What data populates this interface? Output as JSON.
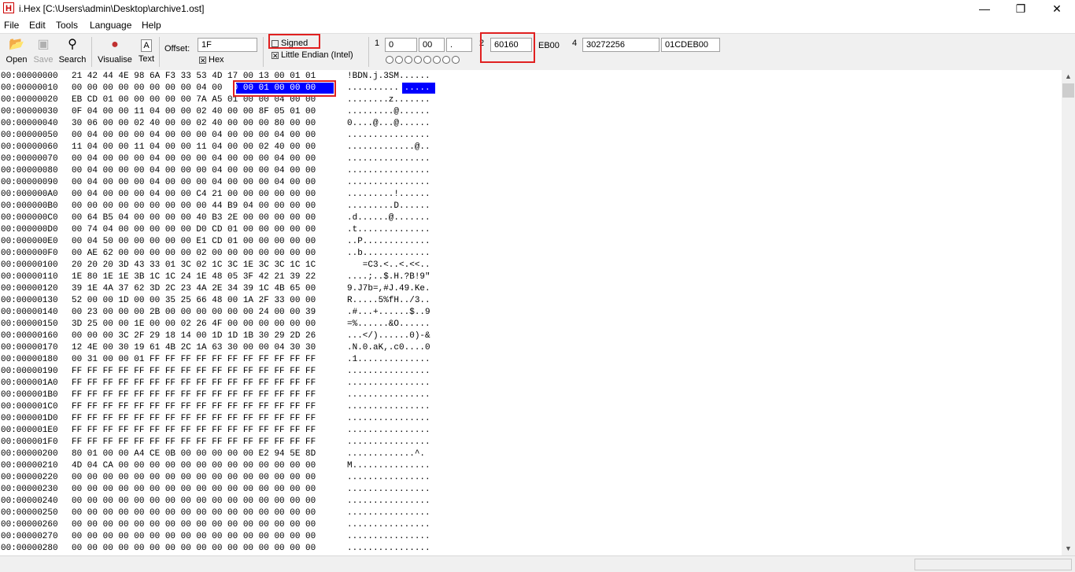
{
  "window": {
    "title": "i.Hex [C:\\Users\\admin\\Desktop\\archive1.ost]",
    "app_icon_glyph": "H",
    "minimize_glyph": "—",
    "restore_glyph": "❐",
    "close_glyph": "✕"
  },
  "menu": [
    "File",
    "Edit",
    "Tools",
    "Language",
    "Help"
  ],
  "toolbar": {
    "open_label": "Open",
    "save_label": "Save",
    "search_label": "Search",
    "visualise_label": "Visualise",
    "text_label": "Text",
    "offset_label": "Offset:",
    "offset_value": "1F",
    "hex_label": "Hex",
    "hex_checked": true,
    "signed_label": "Signed",
    "signed_checked": false,
    "little_endian_label": "Little Endian (Intel)",
    "little_endian_checked": true,
    "label_1": "1",
    "field_1a": "0",
    "field_1b": "00",
    "field_1c": ".",
    "label_2": "2",
    "field_2a": "60160",
    "field_2b": "EB00",
    "label_4": "4",
    "field_4a": "30272256",
    "field_4b": "01CDEB00",
    "bit_circles": 8
  },
  "rows": [
    {
      "off": "00:00000000",
      "hex": "21 42 44 4E 98 6A F3 33 53 4D 17 00 13 00 01 01",
      "asc": "!BDN.j.3SM......"
    },
    {
      "off": "00:00000010",
      "hex": "00 00 00 00 00 00 00 00 04 00 00 00 01 00 00 00",
      "asc": "................"
    },
    {
      "off": "00:00000020",
      "hex": "EB CD 01 00 00 00 00 00 7A A5 01 00 00 04 00 00",
      "asc": "........z......."
    },
    {
      "off": "00:00000030",
      "hex": "0F 04 00 00 11 04 00 00 02 40 00 00 8F 05 01 00",
      "asc": ".........@......"
    },
    {
      "off": "00:00000040",
      "hex": "30 06 00 00 02 40 00 00 02 40 00 00 00 80 00 00",
      "asc": "0....@...@......"
    },
    {
      "off": "00:00000050",
      "hex": "00 04 00 00 00 04 00 00 00 04 00 00 00 04 00 00",
      "asc": "................"
    },
    {
      "off": "00:00000060",
      "hex": "11 04 00 00 11 04 00 00 11 04 00 00 02 40 00 00",
      "asc": ".............@.."
    },
    {
      "off": "00:00000070",
      "hex": "00 04 00 00 00 04 00 00 00 04 00 00 00 04 00 00",
      "asc": "................"
    },
    {
      "off": "00:00000080",
      "hex": "00 04 00 00 00 04 00 00 00 04 00 00 00 04 00 00",
      "asc": "................"
    },
    {
      "off": "00:00000090",
      "hex": "00 04 00 00 00 04 00 00 00 04 00 00 00 04 00 00",
      "asc": "................"
    },
    {
      "off": "00:000000A0",
      "hex": "00 04 00 00 00 04 00 00 C4 21 00 00 00 00 00 00",
      "asc": ".........!......"
    },
    {
      "off": "00:000000B0",
      "hex": "00 00 00 00 00 00 00 00 00 44 B9 04 00 00 00 00",
      "asc": ".........D......"
    },
    {
      "off": "00:000000C0",
      "hex": "00 64 B5 04 00 00 00 00 40 B3 2E 00 00 00 00 00",
      "asc": ".d......@......."
    },
    {
      "off": "00:000000D0",
      "hex": "00 74 04 00 00 00 00 00 D0 CD 01 00 00 00 00 00",
      "asc": ".t.............."
    },
    {
      "off": "00:000000E0",
      "hex": "00 04 50 00 00 00 00 00 E1 CD 01 00 00 00 00 00",
      "asc": "..P............."
    },
    {
      "off": "00:000000F0",
      "hex": "00 AE 62 00 00 00 00 00 02 00 00 00 00 00 00 00",
      "asc": "..b............."
    },
    {
      "off": "00:00000100",
      "hex": "20 20 20 3D 43 33 01 3C 02 1C 3C 1E 3C 3C 1C 1C",
      "asc": "   =C3.<..<.<<.."
    },
    {
      "off": "00:00000110",
      "hex": "1E 80 1E 1E 3B 1C 1C 24 1E 48 05 3F 42 21 39 22",
      "asc": "....;..$.H.?B!9\""
    },
    {
      "off": "00:00000120",
      "hex": "39 1E 4A 37 62 3D 2C 23 4A 2E 34 39 1C 4B 65 00",
      "asc": "9.J7b=,#J.49.Ke."
    },
    {
      "off": "00:00000130",
      "hex": "52 00 00 1D 00 00 35 25 66 48 00 1A 2F 33 00 00",
      "asc": "R.....5%fH../3.."
    },
    {
      "off": "00:00000140",
      "hex": "00 23 00 00 00 2B 00 00 00 00 00 00 24 00 00 39",
      "asc": ".#...+......$..9"
    },
    {
      "off": "00:00000150",
      "hex": "3D 25 00 00 1E 00 00 02 26 4F 00 00 00 00 00 00",
      "asc": "=%......&O......"
    },
    {
      "off": "00:00000160",
      "hex": "00 00 00 3C 2F 29 18 14 00 1D 1D 1B 30 29 2D 26",
      "asc": "...</)......0)-&"
    },
    {
      "off": "00:00000170",
      "hex": "12 4E 00 30 19 61 4B 2C 1A 63 30 00 00 04 30 30",
      "asc": ".N.0.aK,.c0....0"
    },
    {
      "off": "00:00000180",
      "hex": "00 31 00 00 01 FF FF FF FF FF FF FF FF FF FF FF",
      "asc": ".1.............."
    },
    {
      "off": "00:00000190",
      "hex": "FF FF FF FF FF FF FF FF FF FF FF FF FF FF FF FF",
      "asc": "................"
    },
    {
      "off": "00:000001A0",
      "hex": "FF FF FF FF FF FF FF FF FF FF FF FF FF FF FF FF",
      "asc": "................"
    },
    {
      "off": "00:000001B0",
      "hex": "FF FF FF FF FF FF FF FF FF FF FF FF FF FF FF FF",
      "asc": "................"
    },
    {
      "off": "00:000001C0",
      "hex": "FF FF FF FF FF FF FF FF FF FF FF FF FF FF FF FF",
      "asc": "................"
    },
    {
      "off": "00:000001D0",
      "hex": "FF FF FF FF FF FF FF FF FF FF FF FF FF FF FF FF",
      "asc": "................"
    },
    {
      "off": "00:000001E0",
      "hex": "FF FF FF FF FF FF FF FF FF FF FF FF FF FF FF FF",
      "asc": "................"
    },
    {
      "off": "00:000001F0",
      "hex": "FF FF FF FF FF FF FF FF FF FF FF FF FF FF FF FF",
      "asc": "................"
    },
    {
      "off": "00:00000200",
      "hex": "80 01 00 00 A4 CE 0B 00 00 00 00 00 E2 94 5E 8D",
      "asc": ".............^."
    },
    {
      "off": "00:00000210",
      "hex": "4D 04 CA 00 00 00 00 00 00 00 00 00 00 00 00 00",
      "asc": "M..............."
    },
    {
      "off": "00:00000220",
      "hex": "00 00 00 00 00 00 00 00 00 00 00 00 00 00 00 00",
      "asc": "................"
    },
    {
      "off": "00:00000230",
      "hex": "00 00 00 00 00 00 00 00 00 00 00 00 00 00 00 00",
      "asc": "................"
    },
    {
      "off": "00:00000240",
      "hex": "00 00 00 00 00 00 00 00 00 00 00 00 00 00 00 00",
      "asc": "................"
    },
    {
      "off": "00:00000250",
      "hex": "00 00 00 00 00 00 00 00 00 00 00 00 00 00 00 00",
      "asc": "................"
    },
    {
      "off": "00:00000260",
      "hex": "00 00 00 00 00 00 00 00 00 00 00 00 00 00 00 00",
      "asc": "................"
    },
    {
      "off": "00:00000270",
      "hex": "00 00 00 00 00 00 00 00 00 00 00 00 00 00 00 00",
      "asc": "................"
    },
    {
      "off": "00:00000280",
      "hex": "00 00 00 00 00 00 00 00 00 00 00 00 00 00 00 00",
      "asc": "................"
    }
  ],
  "colors": {
    "selection": "#0000ff",
    "highlight_box": "#e02020"
  }
}
